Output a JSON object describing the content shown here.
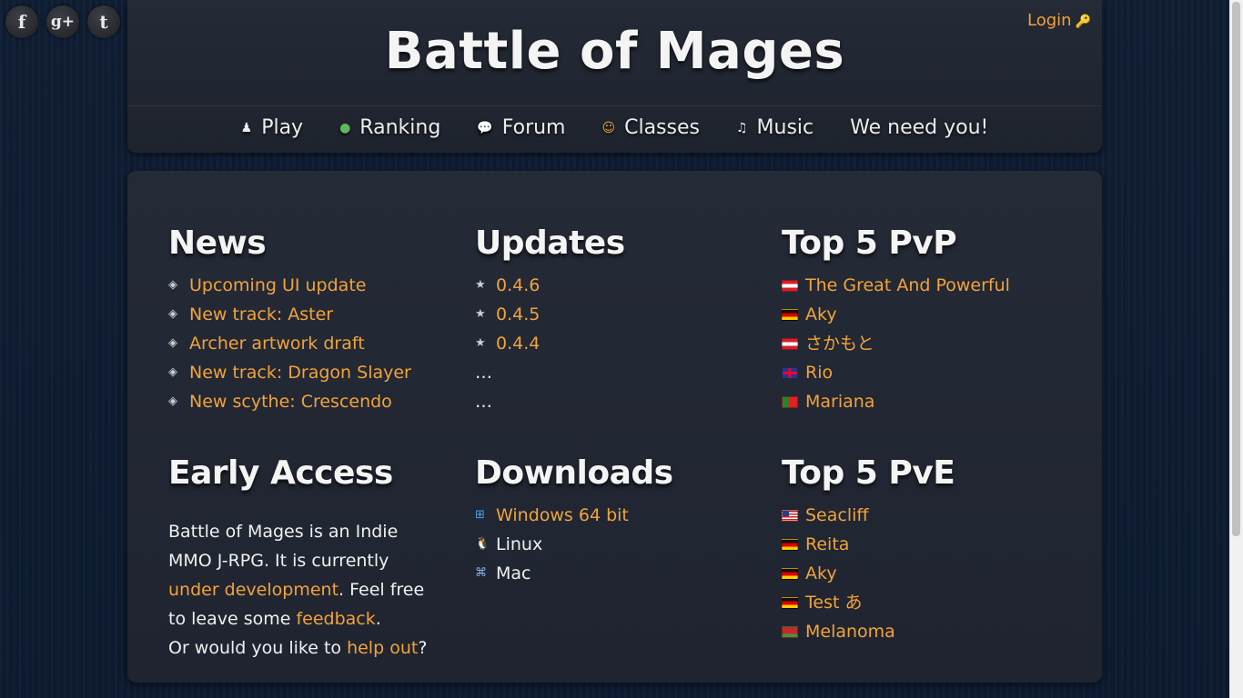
{
  "social": [
    {
      "name": "facebook-icon",
      "glyph": "f"
    },
    {
      "name": "google-plus-icon",
      "glyph": "g+"
    },
    {
      "name": "twitter-icon",
      "glyph": "t"
    }
  ],
  "header": {
    "title": "Battle of Mages",
    "login": "Login",
    "nav": [
      {
        "label": "Play",
        "icon": "play-icon",
        "glyph": "♟"
      },
      {
        "label": "Ranking",
        "icon": "globe-icon",
        "glyph": "●"
      },
      {
        "label": "Forum",
        "icon": "chat-icon",
        "glyph": "💬"
      },
      {
        "label": "Classes",
        "icon": "users-icon",
        "glyph": "☺"
      },
      {
        "label": "Music",
        "icon": "music-icon",
        "glyph": "♫"
      },
      {
        "label": "We need you!",
        "icon": "",
        "glyph": ""
      }
    ]
  },
  "news": {
    "title": "News",
    "items": [
      "Upcoming UI update",
      "New track: Aster",
      "Archer artwork draft",
      "New track: Dragon Slayer",
      "New scythe: Crescendo"
    ]
  },
  "updates": {
    "title": "Updates",
    "items": [
      "0.4.6",
      "0.4.5",
      "0.4.4"
    ],
    "more": [
      "…",
      "…"
    ]
  },
  "pvp": {
    "title": "Top 5 PvP",
    "items": [
      {
        "name": "The Great And Powerful",
        "flag": "at"
      },
      {
        "name": "Aky",
        "flag": "de"
      },
      {
        "name": "さかもと",
        "flag": "at"
      },
      {
        "name": "Rio",
        "flag": "gb"
      },
      {
        "name": "Mariana",
        "flag": "pt"
      }
    ]
  },
  "early": {
    "title": "Early Access",
    "text1": "Battle of Mages is an Indie MMO J-RPG. It is currently ",
    "link1": "under development",
    "text2": ". Feel free to leave some ",
    "link2": "feedback",
    "text3": ".",
    "text4": "Or would you like to ",
    "link3": "help out",
    "text5": "?"
  },
  "downloads": {
    "title": "Downloads",
    "items": [
      {
        "label": "Windows 64 bit",
        "icon": "windows-icon",
        "glyph": "⊞",
        "link": true
      },
      {
        "label": "Linux",
        "icon": "linux-icon",
        "glyph": "🐧",
        "link": false
      },
      {
        "label": "Mac",
        "icon": "mac-icon",
        "glyph": "⌘",
        "link": false
      }
    ]
  },
  "pve": {
    "title": "Top 5 PvE",
    "items": [
      {
        "name": "Seacliff",
        "flag": "us"
      },
      {
        "name": "Reita",
        "flag": "de"
      },
      {
        "name": "Aky",
        "flag": "de"
      },
      {
        "name": "Test あ",
        "flag": "de"
      },
      {
        "name": "Melanoma",
        "flag": "by"
      }
    ]
  }
}
